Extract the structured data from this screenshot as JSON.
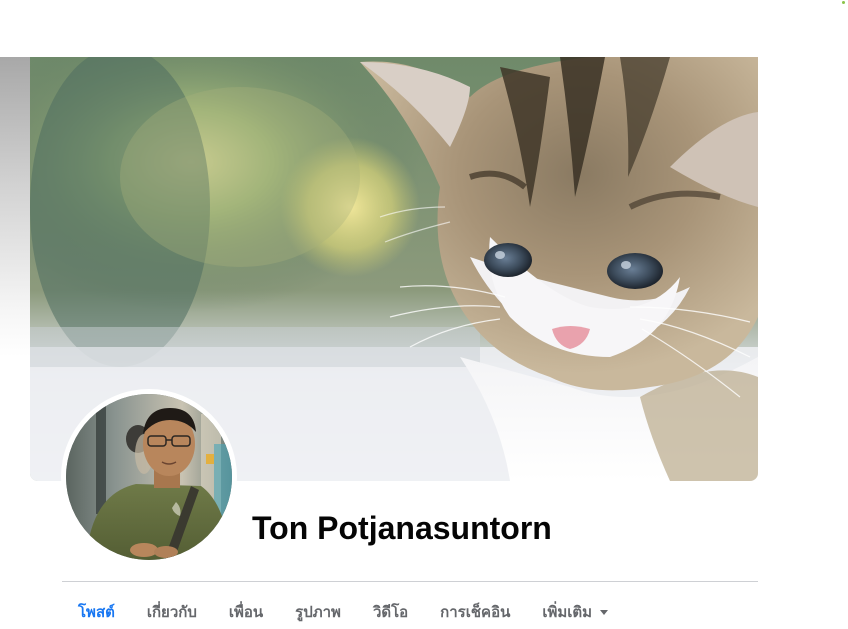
{
  "profile": {
    "name": "Ton Potjanasuntorn"
  },
  "tabs": [
    {
      "label": "โพสต์",
      "active": true
    },
    {
      "label": "เกี่ยวกับ",
      "active": false
    },
    {
      "label": "เพื่อน",
      "active": false
    },
    {
      "label": "รูปภาพ",
      "active": false
    },
    {
      "label": "วิดีโอ",
      "active": false
    },
    {
      "label": "การเช็คอิน",
      "active": false
    },
    {
      "label": "เพิ่มเติม",
      "active": false,
      "icon": "caret-down-icon"
    }
  ],
  "colors": {
    "active_tab": "#1877f2",
    "inactive_tab": "#65676b",
    "name_text": "#050505",
    "divider": "#ced0d4"
  }
}
